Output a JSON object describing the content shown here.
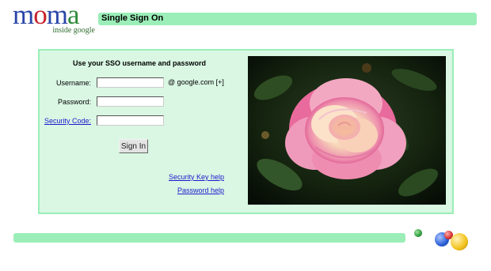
{
  "logo": {
    "letters": [
      {
        "char": "m",
        "color": "#2a46a8"
      },
      {
        "char": "o",
        "color": "#c8202a"
      },
      {
        "char": "m",
        "color": "#2a46a8"
      },
      {
        "char": "a",
        "color": "#2e8b3a"
      }
    ],
    "tagline": "inside google"
  },
  "header": {
    "title": "Single Sign On"
  },
  "form": {
    "heading": "Use your SSO username and password",
    "username_label": "Username:",
    "username_value": "",
    "domain_suffix": "@  google.com [+]",
    "password_label": "Password:",
    "password_value": "",
    "security_code_label": "Security Code:",
    "security_code_value": "",
    "signin_label": "Sign In"
  },
  "links": {
    "security_key_help": "Security Key help",
    "password_help": "Password help"
  },
  "colors": {
    "accent_bar": "#9beeb8",
    "panel_bg": "#d9f7e3",
    "link": "#1a1acc",
    "ball_blue": "#2a5fd6",
    "ball_red": "#d52b2b",
    "ball_yellow": "#f2c21b",
    "ball_green": "#2e9a3a"
  },
  "decor": {
    "photo_subject": "rose-photo",
    "balls": [
      "green-ball-icon",
      "blue-ball-icon",
      "red-ball-icon",
      "yellow-ball-icon"
    ]
  }
}
